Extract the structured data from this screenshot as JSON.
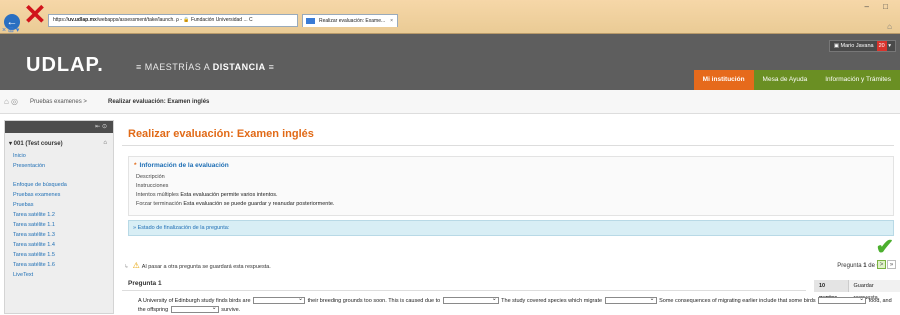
{
  "browser": {
    "address_prefix": "https://",
    "address_host": "uv.udlap.mx",
    "address_rest": "/webapps/assessment/take/launch.",
    "address_icons": "ρ - 🔒 Fundación Universidad ... C",
    "tab_label": "Realizar evaluación: Exame...",
    "tab_close": "×",
    "window_controls": "– □",
    "small_row": "× ⊞ ▾"
  },
  "header": {
    "logo": "UDLAP.",
    "subtitle_prefix": "≡ MAESTRÍAS A ",
    "subtitle_bold": "DISTANCIA",
    "subtitle_suffix": " ≡",
    "user_name": "Mario Javana",
    "user_badge": "20",
    "nav": [
      "Mi institución",
      "Mesa de Ayuda",
      "Información y Trámites"
    ]
  },
  "breadcrumb": {
    "home": "⌂ ◎",
    "item1": "Pruebas examenes",
    "separator": ">",
    "item2": "Realizar evaluación: Examen inglés"
  },
  "sidebar": {
    "tools": "⇤  ⊙",
    "course": "▾  001 (Test course)",
    "home_icon": "⌂",
    "group1": [
      "Inicio",
      "Presentación"
    ],
    "group2": [
      "Enfoque de búsqueda",
      "Pruebas examenes",
      "Pruebas",
      "Tarea satélite 1.2",
      "Tarea satélite 1.1",
      "Tarea satélite 1.3",
      "Tarea satélite 1.4",
      "Tarea satélite 1.5",
      "Tarea satélite 1.6",
      "LiveText"
    ]
  },
  "main": {
    "title": "Realizar evaluación: Examen inglés",
    "info_heading": "Información de la evaluación",
    "info_rows": [
      {
        "label": "Descripción",
        "value": ""
      },
      {
        "label": "Instrucciones",
        "value": ""
      },
      {
        "label": "Intentos múltiples",
        "value": "Esta evaluación permite varios intentos."
      },
      {
        "label": "Forzar terminación",
        "value": "Esta evaluación se puede guardar y reanudar posteriormente."
      }
    ],
    "estado": "» Estado de finalización de la pregunta:",
    "warning": "Al pasar a otra pregunta se guardará esta respuesta.",
    "pager_prefix": "Pregunta ",
    "pager_current": "1",
    "pager_sep": " de ",
    "pager_total": "6",
    "pager_buttons": [
      ">",
      "»"
    ],
    "question_title": "Pregunta 1",
    "points": "10 puntos",
    "save_label": "Guardar respuesta",
    "q_part1": "A University of Edinburgh study finds birds are",
    "q_part2": "their breeding grounds too soon. This is caused due to",
    "q_part3": "The study covered species which migrate",
    "q_part4": "Some consequences of migrating earlier include that some birds",
    "q_part5": "food, and the offspring",
    "q_part6": "survive."
  }
}
